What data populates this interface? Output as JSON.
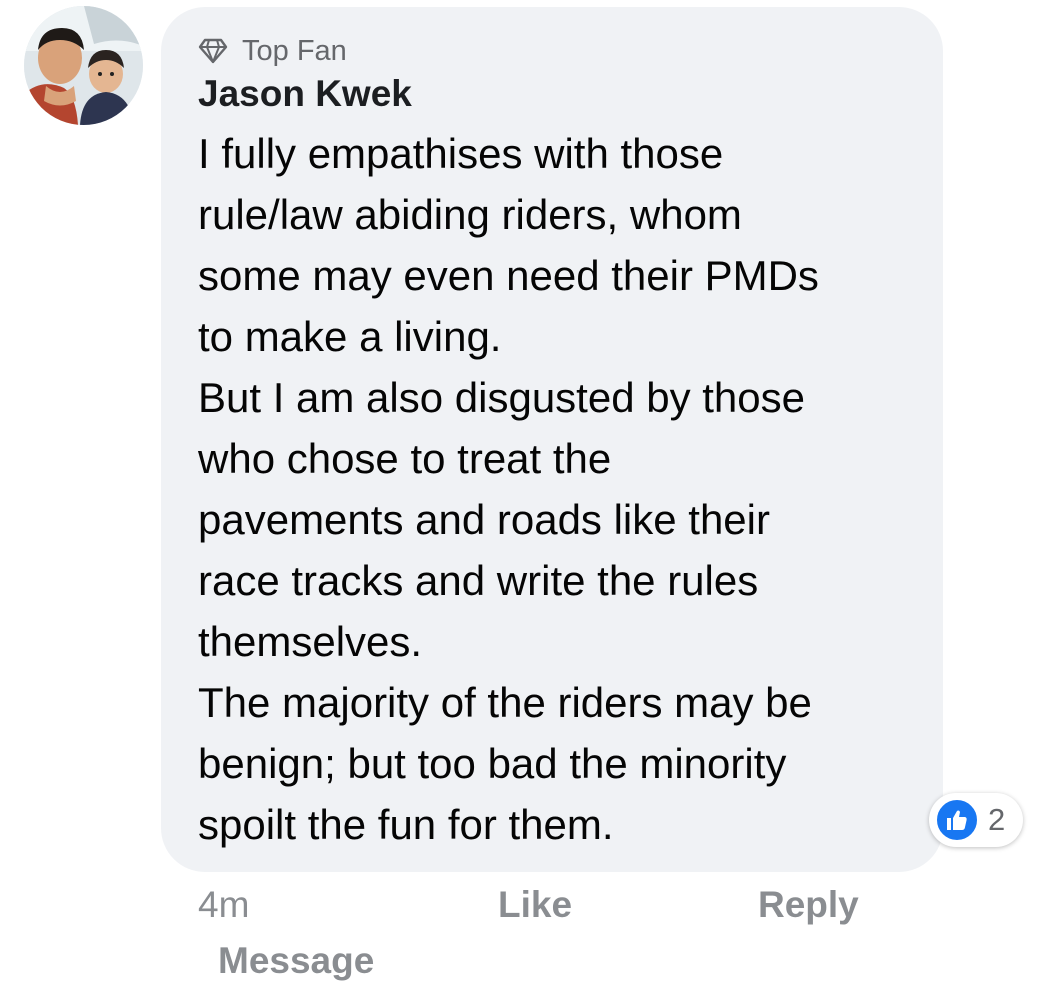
{
  "comment": {
    "avatar_icon": "profile-photo",
    "badge": {
      "icon": "diamond-icon",
      "label": "Top Fan"
    },
    "author": "Jason Kwek",
    "lines": [
      "I fully empathises with those",
      "rule/law abiding riders, whom",
      "some may even need their PMDs",
      "to make a living.",
      "But I am also disgusted by those",
      "who chose to treat the",
      "pavements and roads like their",
      "race tracks and write the rules",
      "themselves.",
      "The majority of the riders may be",
      "benign; but too bad the minority",
      "spoilt the fun for them."
    ],
    "reactions": {
      "icon": "thumbs-up-icon",
      "count": "2",
      "color": "#1877f2"
    }
  },
  "actions": {
    "timestamp": "4m",
    "like_label": "Like",
    "reply_label": "Reply",
    "message_label": "Message"
  },
  "colors": {
    "bubble_bg": "#f0f2f5",
    "action_text": "#8a8d91",
    "accent": "#1877f2"
  }
}
